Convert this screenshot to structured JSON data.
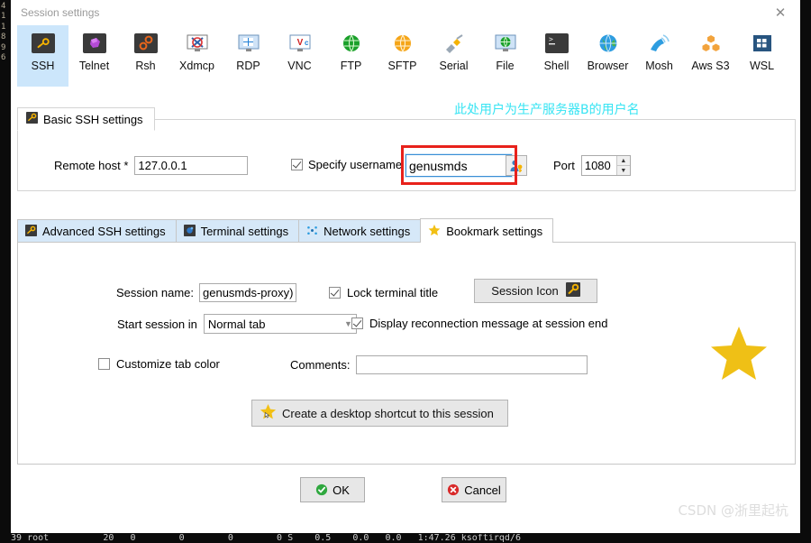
{
  "window": {
    "title": "Session settings",
    "close_label": "✕"
  },
  "protocols": {
    "selected": "SSH",
    "items": [
      {
        "label": "SSH",
        "icon": "ssh-key-icon"
      },
      {
        "label": "Telnet",
        "icon": "telnet-icon"
      },
      {
        "label": "Rsh",
        "icon": "rsh-icon"
      },
      {
        "label": "Xdmcp",
        "icon": "xdmcp-icon"
      },
      {
        "label": "RDP",
        "icon": "rdp-icon"
      },
      {
        "label": "VNC",
        "icon": "vnc-icon"
      },
      {
        "label": "FTP",
        "icon": "ftp-globe-icon"
      },
      {
        "label": "SFTP",
        "icon": "sftp-globe-icon"
      },
      {
        "label": "Serial",
        "icon": "serial-plug-icon"
      },
      {
        "label": "File",
        "icon": "file-monitor-icon"
      },
      {
        "label": "Shell",
        "icon": "shell-terminal-icon"
      },
      {
        "label": "Browser",
        "icon": "browser-globe-icon"
      },
      {
        "label": "Mosh",
        "icon": "mosh-satellite-icon"
      },
      {
        "label": "Aws S3",
        "icon": "aws-s3-icon"
      },
      {
        "label": "WSL",
        "icon": "wsl-windows-icon"
      }
    ]
  },
  "basic_ssh": {
    "tab_label": "Basic SSH settings",
    "remote_host_label": "Remote host *",
    "remote_host_value": "127.0.0.1",
    "specify_username_label": "Specify username",
    "specify_username_checked": true,
    "username_value": "genusmds",
    "port_label": "Port",
    "port_value": "1080"
  },
  "annotation": {
    "chinese_note": "此处用户为生产服务器B的用户名",
    "note_color": "#37e4f3",
    "highlight_color": "#e8211b"
  },
  "tabs": [
    {
      "label": "Advanced SSH settings",
      "icon": "ssh-key-icon",
      "active": false
    },
    {
      "label": "Terminal settings",
      "icon": "terminal-icon",
      "active": false
    },
    {
      "label": "Network settings",
      "icon": "network-dots-icon",
      "active": false
    },
    {
      "label": "Bookmark settings",
      "icon": "star-icon",
      "active": true
    }
  ],
  "bookmark": {
    "session_name_label": "Session name:",
    "session_name_value": "genusmds-proxy)",
    "lock_terminal_title_label": "Lock terminal title",
    "lock_terminal_title_checked": true,
    "session_icon_button_label": "Session Icon",
    "start_session_in_label": "Start session in",
    "start_session_in_value": "Normal tab",
    "display_reconnect_label": "Display reconnection message at session end",
    "display_reconnect_checked": true,
    "customize_tab_color_label": "Customize tab color",
    "customize_tab_color_checked": false,
    "comments_label": "Comments:",
    "comments_value": "",
    "shortcut_button_label": "Create a desktop shortcut to this session"
  },
  "footer": {
    "ok_label": "OK",
    "cancel_label": "Cancel"
  },
  "watermark": "CSDN @浙里起杭",
  "terminal_bg": {
    "left_column": "4\n1\n1\n8\n9\n6",
    "bottom_row": "  39 root          20   0        0        0        0 S    0.5    0.0   0.0   1:47.26 ksoftirqd/6"
  }
}
